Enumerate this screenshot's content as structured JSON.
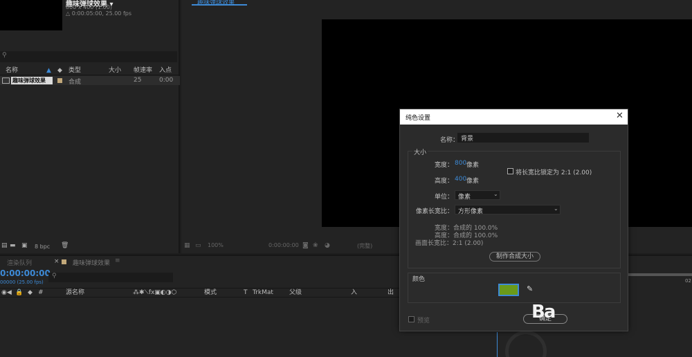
{
  "project": {
    "comp_name": "趣味弹球效果 ▾",
    "comp_size": "800 x 400 (1.00)",
    "comp_duration": "△ 0:00:05:00, 25.00 fps",
    "columns": {
      "name": "名称",
      "type": "类型",
      "size": "大小",
      "fps": "帧速率",
      "in": "入点"
    },
    "row": {
      "name": "趣味弹球效果",
      "type": "合成",
      "fps": "25",
      "in": "0:00"
    },
    "bpc": "8 bpc"
  },
  "viewer": {
    "tab": "趣味弹球效果",
    "zoom": "100%",
    "time": "0:00:00:00",
    "quality": "(完整)"
  },
  "timeline": {
    "tab_render": "渲染队列",
    "tab_close": "×",
    "tab_comp": "趣味弹球效果",
    "tab_menu": "≡",
    "timecode": "0:00:00:00",
    "timecode_sub": "00000 (25.00 fps)",
    "columns": {
      "source": "源名称",
      "mode": "模式",
      "t": "T",
      "trkmat": "TrkMat",
      "parent": "父级",
      "in": "入",
      "out": "出"
    },
    "ruler_label": "02"
  },
  "dialog": {
    "title": "纯色设置",
    "close": "✕",
    "name_label": "名称：",
    "name_value": "背景",
    "size_group": "大小",
    "width_label": "宽度：",
    "width_value": "800",
    "width_unit": "像素",
    "height_label": "高度：",
    "height_value": "400",
    "height_unit": "像素",
    "lock_label": "将长宽比锁定为 2:1 (2.00)",
    "unit_label": "单位：",
    "unit_value": "像素",
    "pixel_aspect_label": "像素长宽比：",
    "pixel_aspect_value": "方形像素",
    "comp_width": "宽度：合成的 100.0%",
    "comp_height": "高度：合成的 100.0%",
    "frame_aspect": "画面长宽比：2:1 (2.00)",
    "make_comp_size": "制作合成大小",
    "color_group": "颜色",
    "color_value": "#6a9a1a",
    "preview_label": "预览",
    "ok_label": "确定"
  },
  "watermark": "Ba"
}
